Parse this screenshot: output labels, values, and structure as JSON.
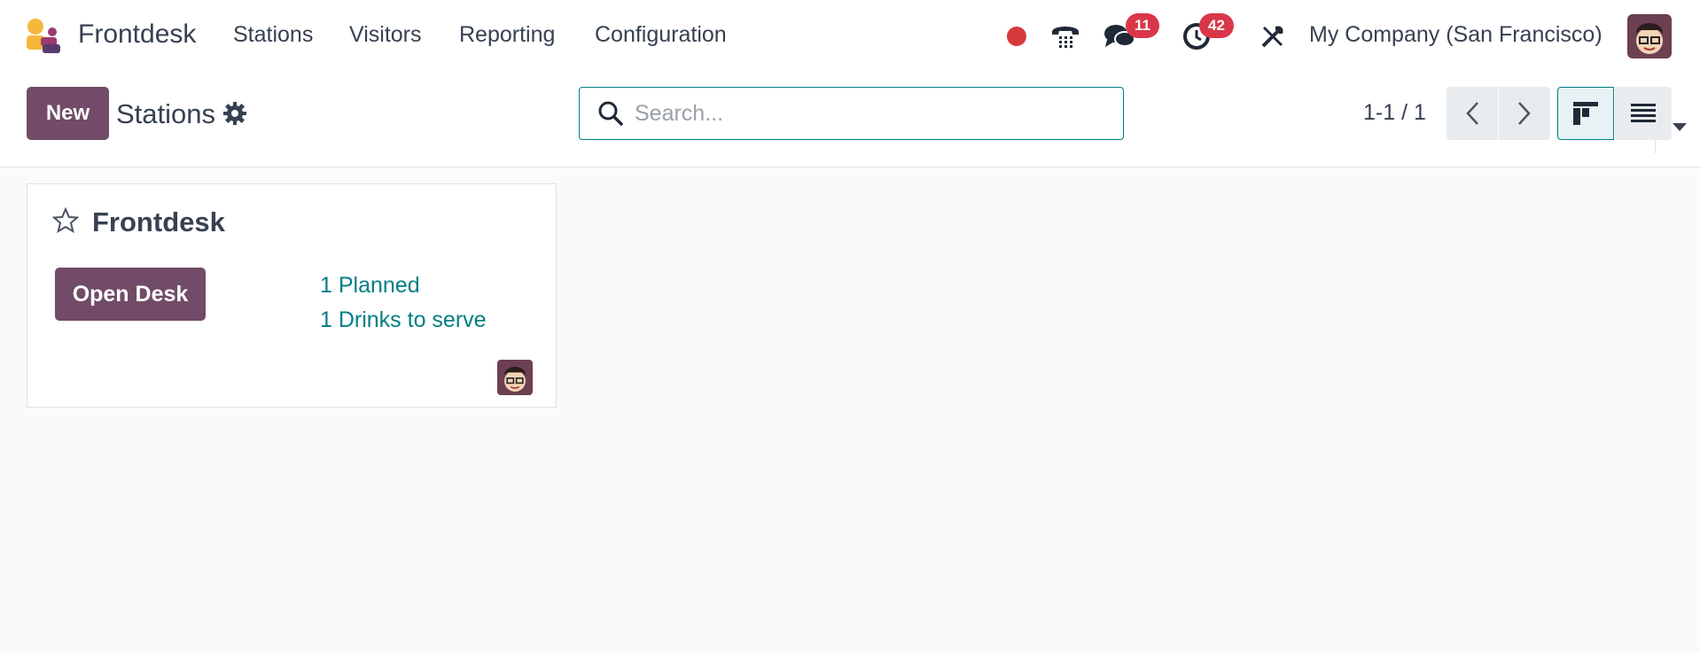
{
  "navbar": {
    "app_name": "Frontdesk",
    "menu": [
      "Stations",
      "Visitors",
      "Reporting",
      "Configuration"
    ],
    "messages_count": "11",
    "activities_count": "42",
    "company": "My Company (San Francisco)"
  },
  "control_panel": {
    "new_label": "New",
    "title": "Stations",
    "search_placeholder": "Search...",
    "pager": "1-1 / 1"
  },
  "card": {
    "title": "Frontdesk",
    "open_desk_label": "Open Desk",
    "planned": "1 Planned",
    "drinks": "1 Drinks to serve"
  },
  "colors": {
    "brand": "#714b67",
    "link": "#017e84",
    "badge": "#d9364a",
    "status_dot": "#d63a3a"
  }
}
